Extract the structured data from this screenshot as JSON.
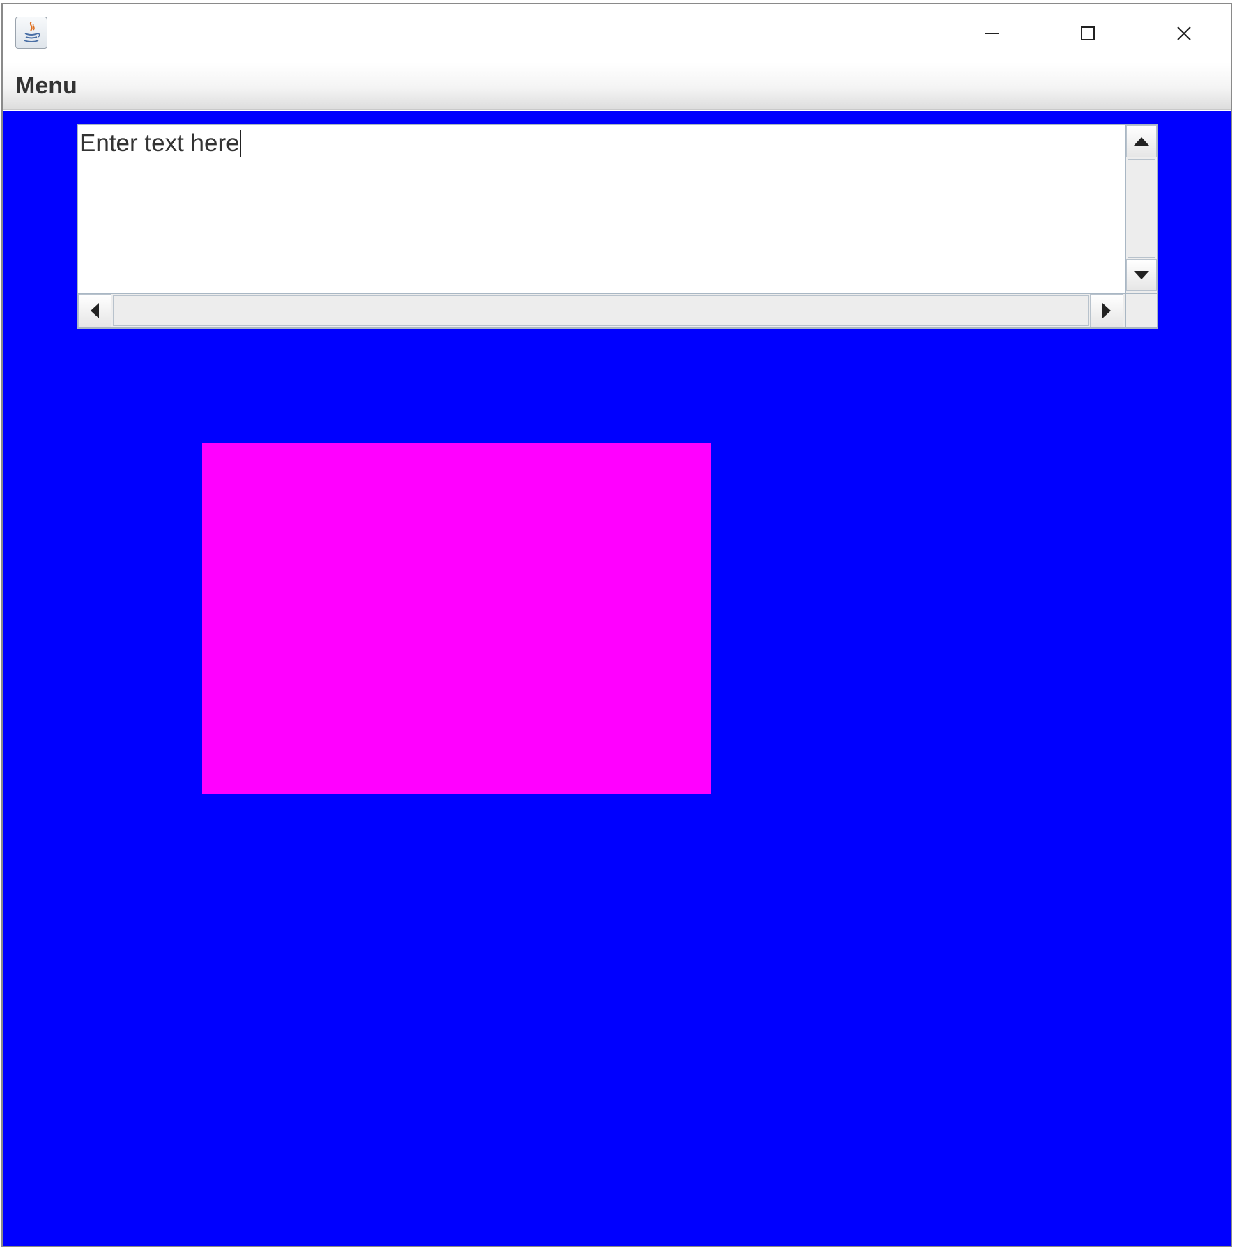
{
  "window": {
    "icon": "java-icon",
    "controls": {
      "minimize_icon": "minimize-icon",
      "maximize_icon": "maximize-icon",
      "close_icon": "close-icon"
    }
  },
  "menubar": {
    "items": [
      {
        "label": "Menu"
      }
    ]
  },
  "text_area": {
    "value": "Enter text here"
  },
  "colors": {
    "content_background": "#0000ff",
    "rectangle_fill": "#ff00ff"
  }
}
